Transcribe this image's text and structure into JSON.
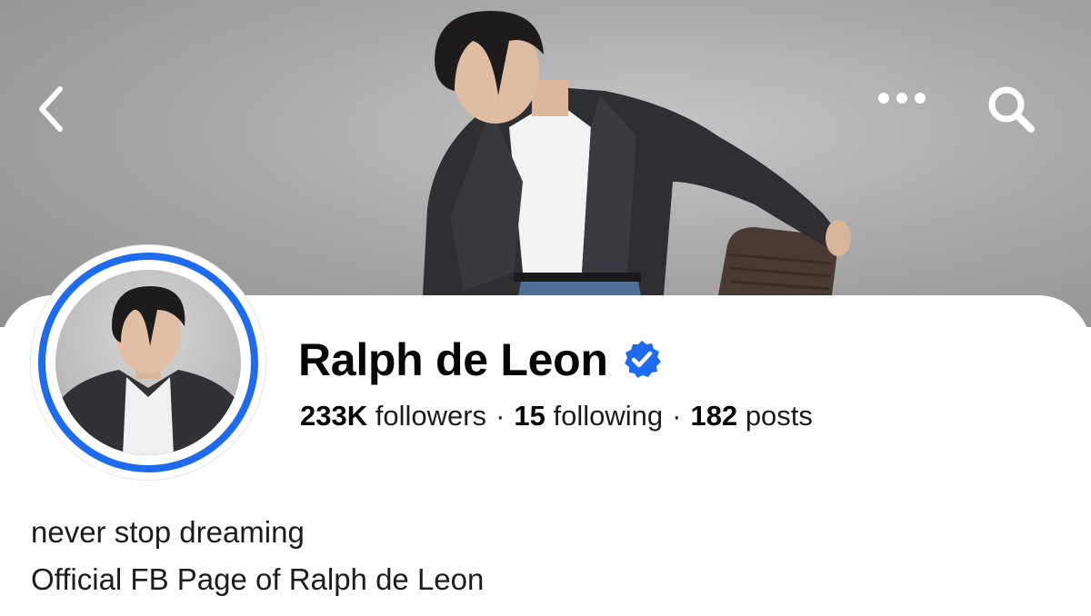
{
  "nav": {
    "back_icon": "chevron-left-icon",
    "more_icon": "more-horizontal-icon",
    "search_icon": "search-icon"
  },
  "profile": {
    "name": "Ralph de Leon",
    "verified_icon": "verified-badge-icon",
    "followers_count": "233K",
    "followers_label": "followers",
    "following_count": "15",
    "following_label": "following",
    "posts_count": "182",
    "posts_label": "posts",
    "separator": "·"
  },
  "bio": {
    "line1": "never stop dreaming",
    "line2": "Official FB Page of Ralph de Leon"
  },
  "colors": {
    "accent": "#1f6bf0",
    "text_primary": "#050505",
    "background": "#ffffff"
  }
}
